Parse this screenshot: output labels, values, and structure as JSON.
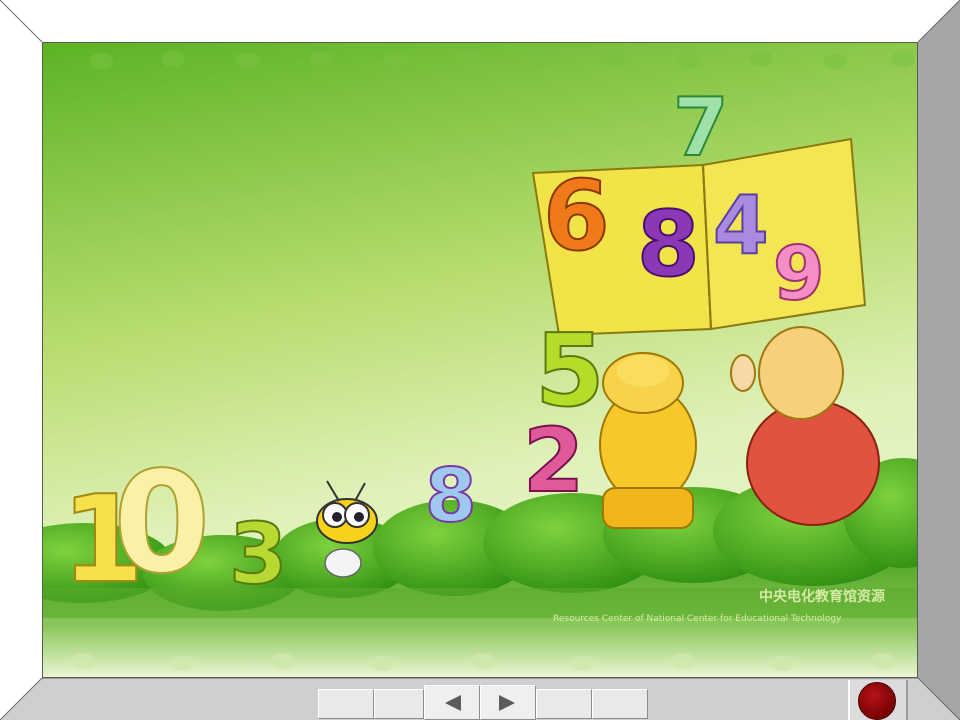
{
  "presentation": {
    "watermark": {
      "title": "中央电化教育馆资源",
      "subtitle": "Resources Center of National Center for Educational Technology"
    },
    "numerals": [
      "1",
      "0",
      "3",
      "8",
      "2",
      "5",
      "6",
      "8",
      "4",
      "9",
      "7"
    ]
  },
  "controls": {
    "prev_icon": "triangle-left-icon",
    "next_icon": "triangle-right-icon",
    "record_icon": "record-dot-icon"
  },
  "colors": {
    "background_light": "#dcefb3",
    "background_dark": "#4fae1c",
    "book": "#f2e448",
    "frame_gray": "#a9a9a9",
    "record_red": "#8b0000"
  }
}
